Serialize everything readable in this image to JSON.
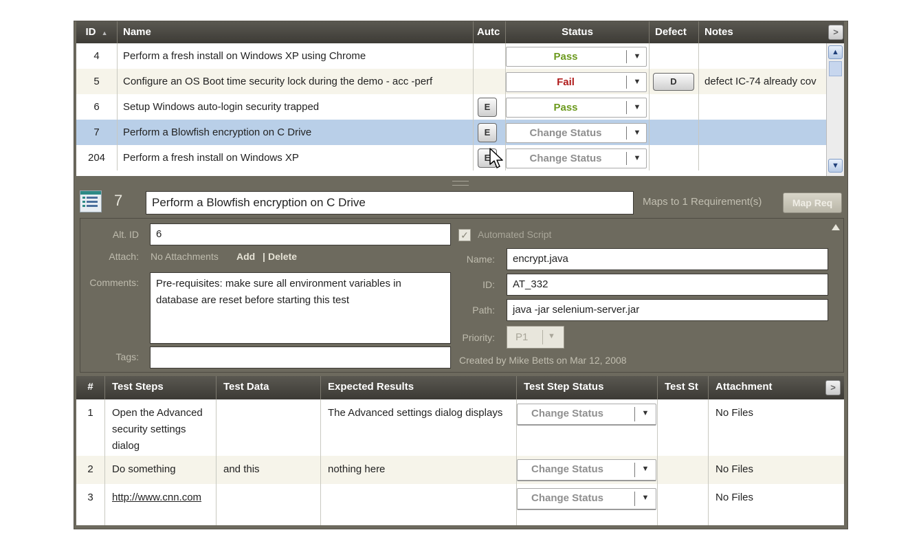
{
  "top_grid": {
    "headers": {
      "id": "ID",
      "sort_arrow": "▲",
      "name": "Name",
      "auto": "Autc",
      "status": "Status",
      "defect": "Defect",
      "notes": "Notes"
    },
    "rows": [
      {
        "id": "4",
        "name": "Perform a fresh install on Windows XP using Chrome",
        "auto": "",
        "status": "Pass",
        "defect": "",
        "notes": ""
      },
      {
        "id": "5",
        "name": "Configure an OS Boot time security lock during the demo - acc -perf",
        "auto": "",
        "status": "Fail",
        "defect": "D",
        "notes": "defect IC-74 already cov"
      },
      {
        "id": "6",
        "name": "Setup Windows auto-login security trapped",
        "auto": "E",
        "status": "Pass",
        "defect": "",
        "notes": ""
      },
      {
        "id": "7",
        "name": "Perform a Blowfish encryption on C Drive",
        "auto": "E",
        "status": "Change Status",
        "defect": "",
        "notes": ""
      },
      {
        "id": "204",
        "name": "Perform a fresh install on Windows XP",
        "auto": "E",
        "status": "Change Status",
        "defect": "",
        "notes": ""
      }
    ]
  },
  "detail": {
    "id": "7",
    "title": "Perform a Blowfish encryption on C Drive",
    "maps_text": "Maps to 1 Requirement(s)",
    "map_req_button": "Map Req",
    "alt_id_label": "Alt. ID",
    "alt_id_value": "6",
    "attach_label": "Attach:",
    "attach_value": "No Attachments",
    "attach_add": "Add",
    "attach_sep": "|",
    "attach_delete": "Delete",
    "comments_label": "Comments:",
    "comments_value": "Pre-requisites: make sure all environment variables in database are reset before starting this test",
    "tags_label": "Tags:",
    "tags_value": "",
    "automated_label": "Automated Script",
    "name_label": "Name:",
    "name_value": "encrypt.java",
    "id_label": "ID:",
    "id_value": "AT_332",
    "path_label": "Path:",
    "path_value": "java -jar selenium-server.jar",
    "priority_label": "Priority:",
    "priority_value": "P1",
    "created_text": "Created by Mike Betts on Mar 12, 2008"
  },
  "steps_grid": {
    "headers": {
      "num": "#",
      "steps": "Test Steps",
      "data": "Test Data",
      "expected": "Expected Results",
      "step_status": "Test Step Status",
      "test_st": "Test St",
      "attachment": "Attachment"
    },
    "rows": [
      {
        "num": "1",
        "step": "Open the Advanced security settings dialog",
        "data": "",
        "expected": "The Advanced settings dialog displays",
        "status": "Change Status",
        "attachment": "No Files"
      },
      {
        "num": "2",
        "step": "Do something",
        "data": "and this",
        "expected": "nothing here",
        "status": "Change Status",
        "attachment": "No Files"
      },
      {
        "num": "3",
        "step": "http://www.cnn.com",
        "data": "",
        "expected": "",
        "status": "Change Status",
        "attachment": "No Files"
      }
    ]
  },
  "colors": {
    "pass": "#6c9a1e",
    "fail": "#b01c1c",
    "change": "#8f8f8f",
    "selected_row": "#b9cfe8",
    "alt_row": "#f6f4ea",
    "panel": "#6d6a5e"
  }
}
